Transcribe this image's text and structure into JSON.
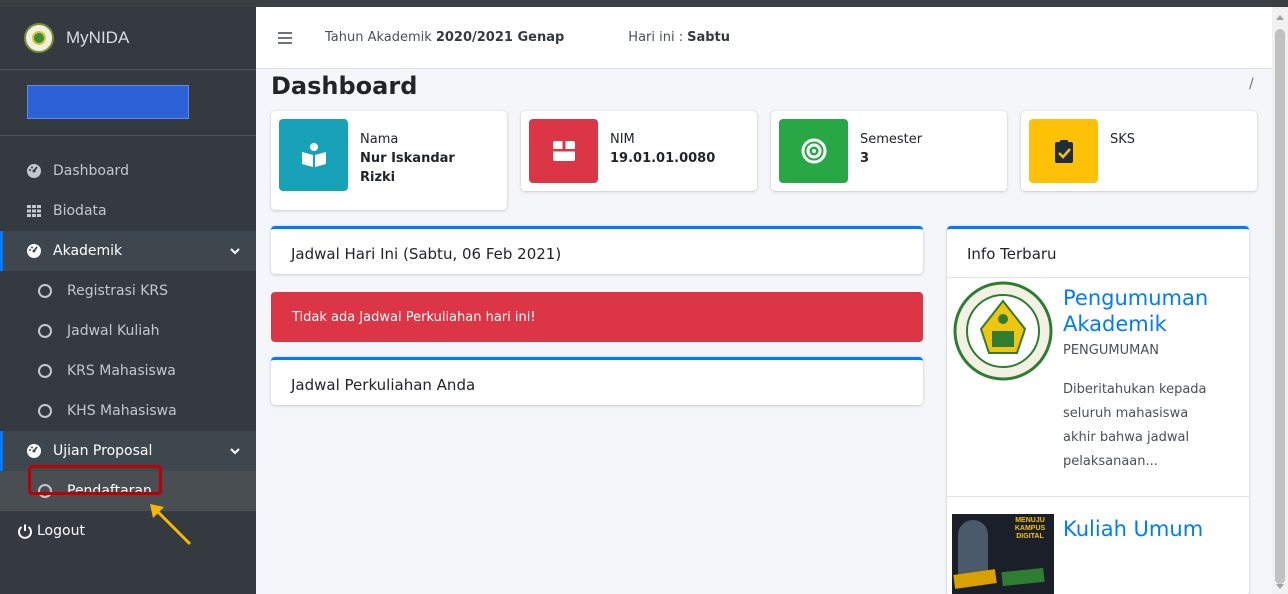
{
  "brand": {
    "name": "MyNIDA"
  },
  "user": {
    "name": ""
  },
  "sidebar": {
    "items": [
      {
        "label": "Dashboard",
        "icon": "tachometer-icon"
      },
      {
        "label": "Biodata",
        "icon": "grid-icon"
      },
      {
        "label": "Akademik",
        "icon": "tachometer-icon"
      },
      {
        "label": "Registrasi KRS"
      },
      {
        "label": "Jadwal Kuliah"
      },
      {
        "label": "KRS Mahasiswa"
      },
      {
        "label": "KHS Mahasiswa"
      },
      {
        "label": "Ujian Proposal",
        "icon": "tachometer-icon"
      },
      {
        "label": "Pendaftaran"
      }
    ],
    "logout": "Logout"
  },
  "topbar": {
    "year_label": "Tahun Akademik",
    "year_value": "2020/2021 Genap",
    "day_label": "Hari ini :",
    "day_value": "Sabtu"
  },
  "page": {
    "title": "Dashboard",
    "breadcrumb": "/"
  },
  "info_boxes": [
    {
      "label": "Nama",
      "value": "Nur Iskandar Rizki",
      "color": "#17a2b8",
      "icon": "reader-icon"
    },
    {
      "label": "NIM",
      "value": "19.01.01.0080",
      "color": "#dc3545",
      "icon": "box-icon"
    },
    {
      "label": "Semester",
      "value": "3",
      "color": "#28a745",
      "icon": "target-icon"
    },
    {
      "label": "SKS",
      "value": "",
      "color": "#ffc107",
      "icon": "clipboard-check-icon"
    }
  ],
  "schedule": {
    "today_title": "Jadwal Hari Ini (Sabtu, 06 Feb 2021)",
    "alert": "Tidak ada Jadwal Perkuliahan hari ini!",
    "yours_title": "Jadwal Perkuliahan Anda"
  },
  "news": {
    "title": "Info Terbaru",
    "items": [
      {
        "title": "Pengumuman Akademik",
        "category": "PENGUMUMAN",
        "excerpt": "Diberitahukan kepada seluruh mahasiswa akhir bahwa jadwal pelaksanaan..."
      },
      {
        "title": "Kuliah Umum",
        "image_text": "MENUJU KAMPUS DIGITAL"
      }
    ]
  }
}
